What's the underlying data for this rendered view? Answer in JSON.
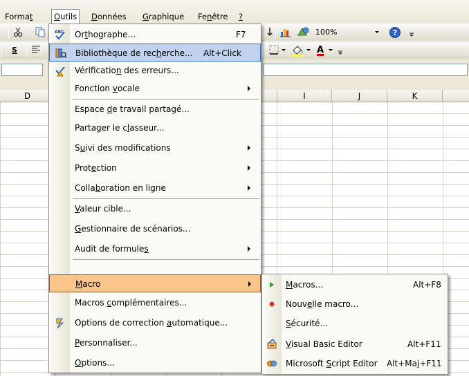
{
  "menubar": {
    "items": [
      {
        "pre": "Forma",
        "key": "t",
        "post": ""
      },
      {
        "pre": "",
        "key": "O",
        "post": "utils"
      },
      {
        "pre": "",
        "key": "D",
        "post": "onnées"
      },
      {
        "pre": "",
        "key": "G",
        "post": "raphique"
      },
      {
        "pre": "Fe",
        "key": "n",
        "post": "être"
      },
      {
        "pre": "",
        "key": "?",
        "post": ""
      }
    ]
  },
  "toolbar": {
    "zoom": "100%",
    "bold_label": "S",
    "font_color_label": "A"
  },
  "columns": [
    "D",
    "I",
    "J",
    "K"
  ],
  "menu": {
    "items": [
      {
        "pre": "Or",
        "key": "t",
        "post": "hographe...",
        "shortcut": "F7"
      },
      {
        "pre": "Bibliothèque de rec",
        "key": "h",
        "post": "erche...",
        "shortcut": "Alt+Click"
      },
      {
        "pre": "Vérificatio",
        "key": "n",
        "post": " des erreurs...",
        "shortcut": ""
      },
      {
        "pre": "Fonction ",
        "key": "v",
        "post": "ocale",
        "shortcut": ""
      },
      {
        "pre": "Espace ",
        "key": "d",
        "post": "e travail partagé...",
        "shortcut": ""
      },
      {
        "pre": "Partager le c",
        "key": "l",
        "post": "asseur...",
        "shortcut": ""
      },
      {
        "pre": "S",
        "key": "u",
        "post": "ivi des modifications",
        "shortcut": ""
      },
      {
        "pre": "Prot",
        "key": "e",
        "post": "ction",
        "shortcut": ""
      },
      {
        "pre": "Colla",
        "key": "b",
        "post": "oration en ligne",
        "shortcut": ""
      },
      {
        "pre": "",
        "key": "V",
        "post": "aleur cible...",
        "shortcut": ""
      },
      {
        "pre": "",
        "key": "G",
        "post": "estionnaire de scénarios...",
        "shortcut": ""
      },
      {
        "pre": "Audit de formule",
        "key": "s",
        "post": "",
        "shortcut": ""
      },
      {
        "pre": "",
        "key": "M",
        "post": "acro",
        "shortcut": ""
      },
      {
        "pre": "Macros ",
        "key": "c",
        "post": "omplémentaires...",
        "shortcut": ""
      },
      {
        "pre": "Options de correction ",
        "key": "a",
        "post": "utomatique...",
        "shortcut": ""
      },
      {
        "pre": "",
        "key": "P",
        "post": "ersonnaliser...",
        "shortcut": ""
      },
      {
        "pre": "",
        "key": "O",
        "post": "ptions...",
        "shortcut": ""
      }
    ]
  },
  "submenu": {
    "items": [
      {
        "pre": "",
        "key": "M",
        "post": "acros...",
        "shortcut": "Alt+F8"
      },
      {
        "pre": "Nouv",
        "key": "e",
        "post": "lle macro...",
        "shortcut": ""
      },
      {
        "pre": "",
        "key": "S",
        "post": "écurité...",
        "shortcut": ""
      },
      {
        "pre": "",
        "key": "V",
        "post": "isual Basic Editor",
        "shortcut": "Alt+F11"
      },
      {
        "pre": "Microsoft ",
        "key": "S",
        "post": "cript Editor",
        "shortcut": "Alt+Maj+F11"
      }
    ]
  }
}
